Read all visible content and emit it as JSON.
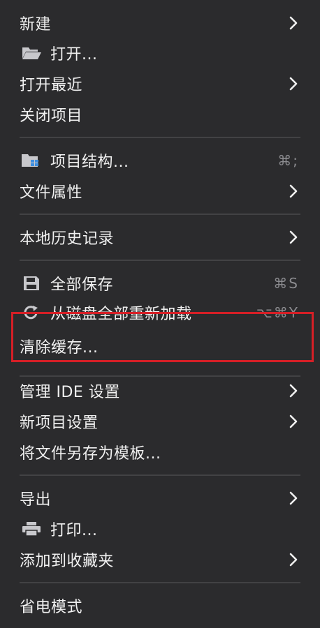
{
  "menu": {
    "new": {
      "label": "新建"
    },
    "open": {
      "label": "打开..."
    },
    "open_recent": {
      "label": "打开最近"
    },
    "close_project": {
      "label": "关闭项目"
    },
    "project_structure": {
      "label": "项目结构...",
      "shortcut": "⌘;"
    },
    "file_properties": {
      "label": "文件属性"
    },
    "local_history": {
      "label": "本地历史记录"
    },
    "save_all": {
      "label": "全部保存",
      "shortcut": "⌘S"
    },
    "reload_from_disk": {
      "label": "从磁盘全部重新加载",
      "shortcut": "⌥⌘Y"
    },
    "invalidate_caches": {
      "label": "清除缓存..."
    },
    "manage_ide_settings": {
      "label": "管理 IDE 设置"
    },
    "new_project_settings": {
      "label": "新项目设置"
    },
    "save_as_template": {
      "label": "将文件另存为模板..."
    },
    "export": {
      "label": "导出"
    },
    "print": {
      "label": "打印..."
    },
    "add_to_favorites": {
      "label": "添加到收藏夹"
    },
    "power_save_mode": {
      "label": "省电模式"
    }
  },
  "colors": {
    "background": "#2b2b2d",
    "text": "#f0f0f0",
    "shortcut": "#8b8b8f",
    "separator": "#424244",
    "highlight_box": "#d61f26"
  }
}
